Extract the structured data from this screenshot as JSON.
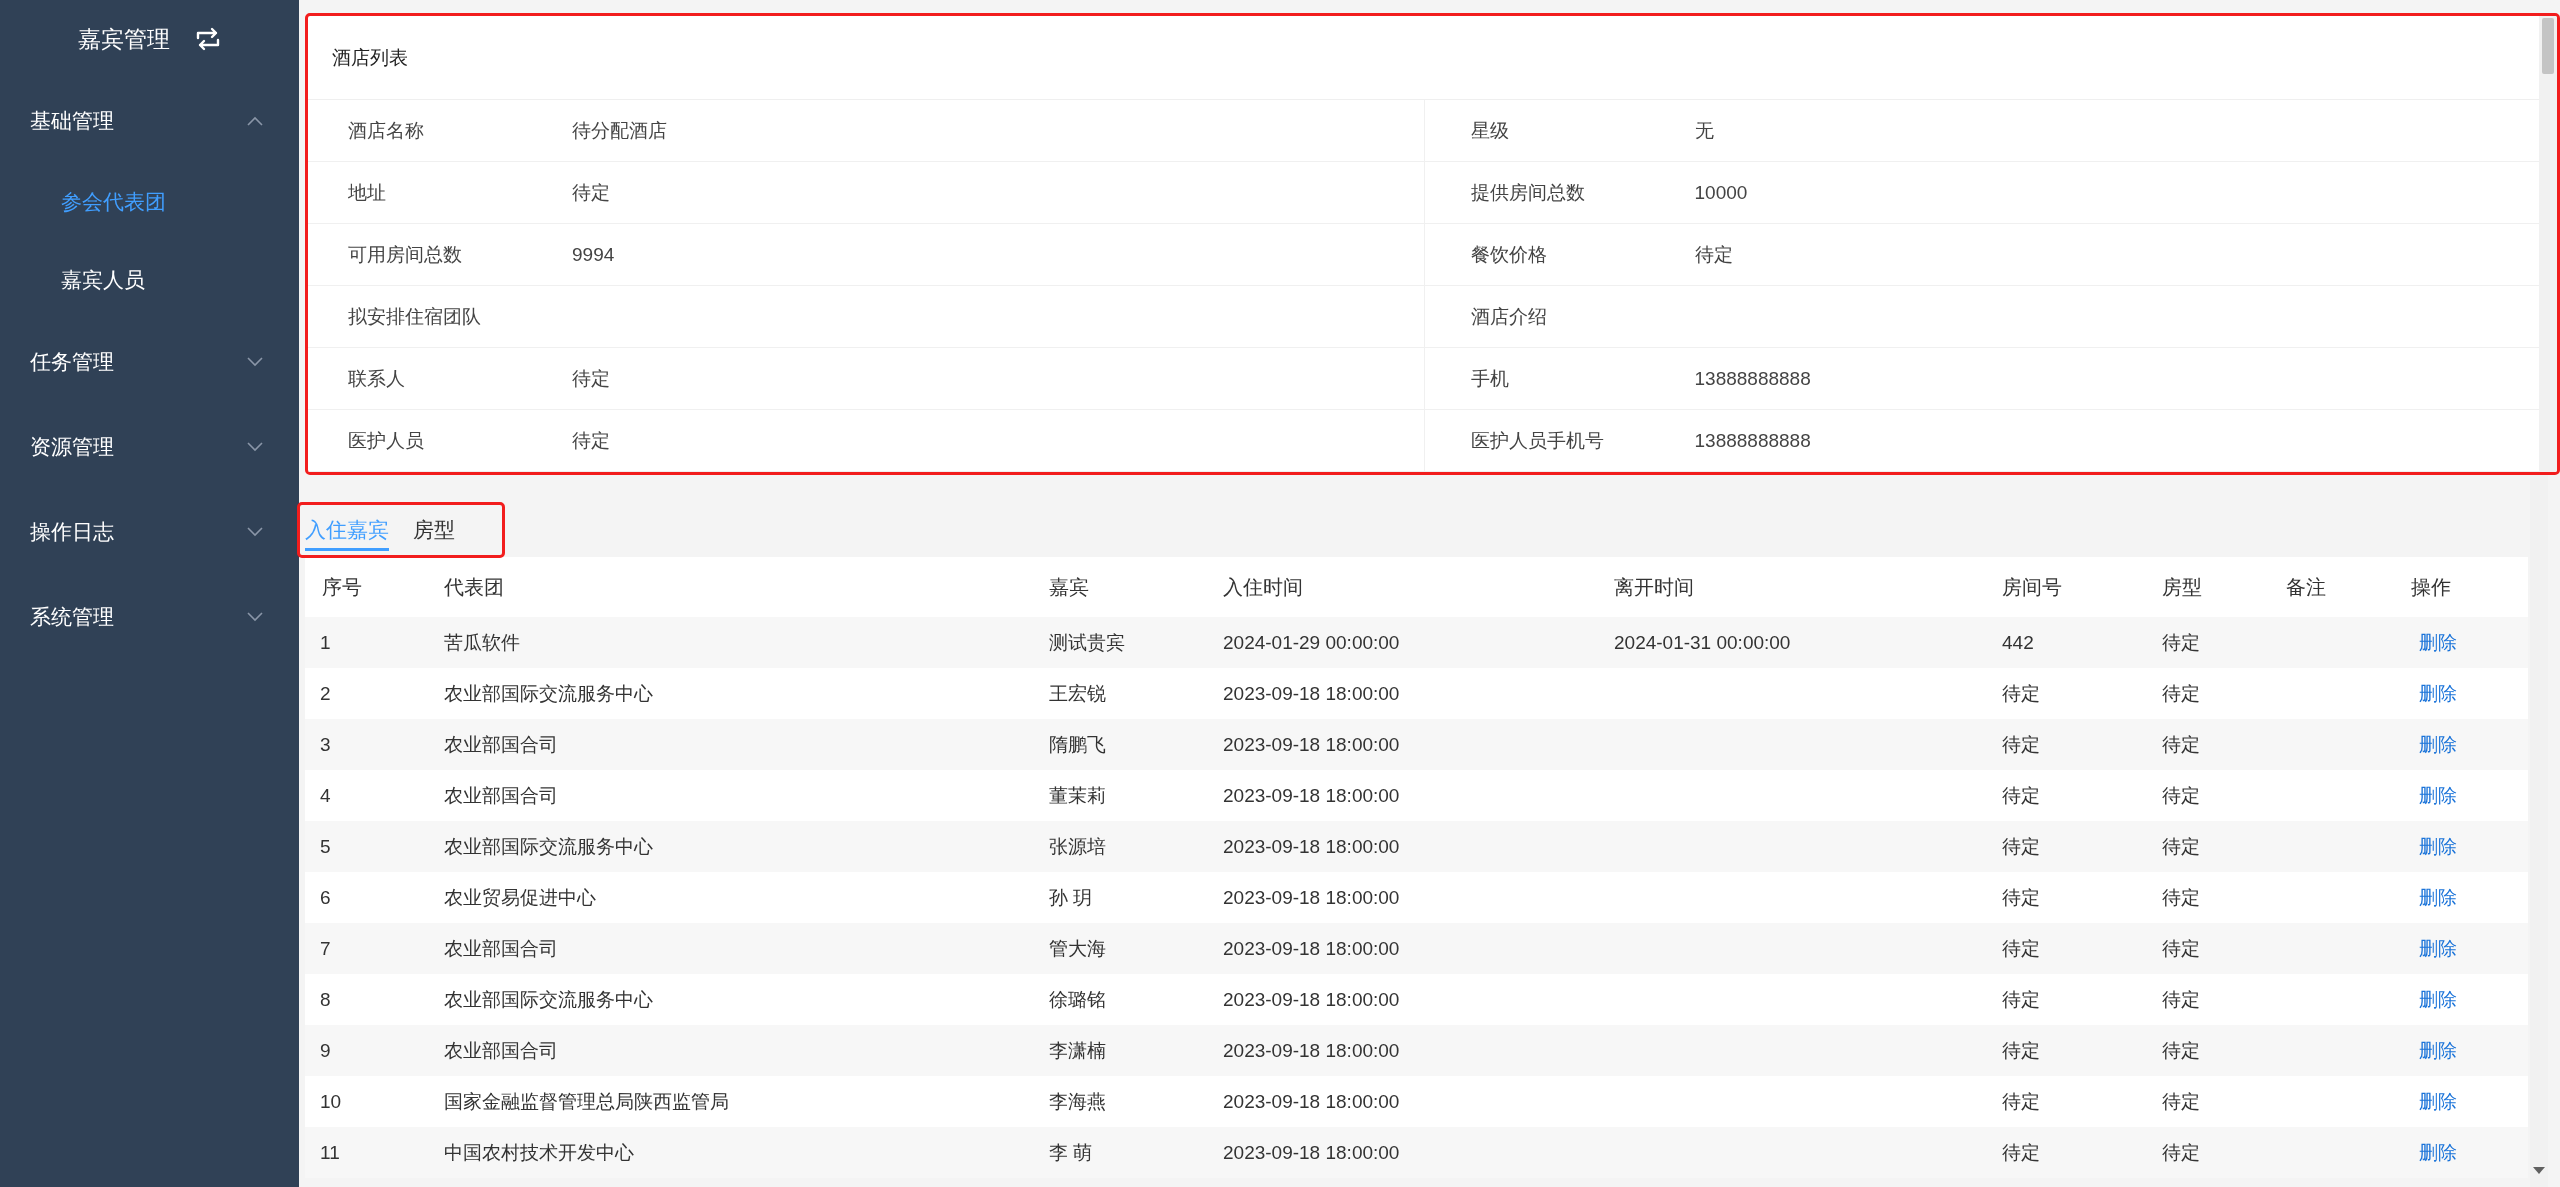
{
  "sidebar": {
    "title": "嘉宾管理",
    "groups": [
      {
        "label": "基础管理",
        "expanded": true,
        "children": [
          {
            "label": "参会代表团",
            "selected": true
          },
          {
            "label": "嘉宾人员",
            "selected": false
          }
        ]
      },
      {
        "label": "任务管理",
        "expanded": false
      },
      {
        "label": "资源管理",
        "expanded": false
      },
      {
        "label": "操作日志",
        "expanded": false
      },
      {
        "label": "系统管理",
        "expanded": false
      }
    ]
  },
  "hotel_card": {
    "title": "酒店列表",
    "fields": [
      {
        "label": "酒店名称",
        "value": "待分配酒店"
      },
      {
        "label": "星级",
        "value": "无"
      },
      {
        "label": "地址",
        "value": "待定"
      },
      {
        "label": "提供房间总数",
        "value": "10000"
      },
      {
        "label": "可用房间总数",
        "value": "9994"
      },
      {
        "label": "餐饮价格",
        "value": "待定"
      },
      {
        "label": "拟安排住宿团队"
      },
      {
        "label": "酒店介绍"
      },
      {
        "label": "联系人",
        "value": "待定"
      },
      {
        "label": "手机",
        "value": "13888888888"
      },
      {
        "label": "医护人员",
        "value": "待定"
      },
      {
        "label": "医护人员手机号",
        "value": "13888888888"
      }
    ]
  },
  "tabs": [
    {
      "label": "入住嘉宾",
      "selected": true
    },
    {
      "label": "房型",
      "selected": false
    }
  ],
  "table": {
    "columns": [
      "序号",
      "代表团",
      "嘉宾",
      "入住时间",
      "离开时间",
      "房间号",
      "房型",
      "备注",
      "操作"
    ],
    "rows": [
      {
        "no": "1",
        "delegation": "苦瓜软件",
        "guest": "测试贵宾",
        "check_in": "2024-01-29 00:00:00",
        "check_out": "2024-01-31 00:00:00",
        "room_no": "442",
        "room_type": "待定",
        "action": "删除"
      },
      {
        "no": "2",
        "delegation": "农业部国际交流服务中心",
        "guest": "王宏锐",
        "check_in": "2023-09-18 18:00:00",
        "room_no": "待定",
        "room_type": "待定",
        "action": "删除"
      },
      {
        "no": "3",
        "delegation": "农业部国合司",
        "guest": "隋鹏飞",
        "check_in": "2023-09-18 18:00:00",
        "room_no": "待定",
        "room_type": "待定",
        "action": "删除"
      },
      {
        "no": "4",
        "delegation": "农业部国合司",
        "guest": "董茉莉",
        "check_in": "2023-09-18 18:00:00",
        "room_no": "待定",
        "room_type": "待定",
        "action": "删除"
      },
      {
        "no": "5",
        "delegation": "农业部国际交流服务中心",
        "guest": "张源培",
        "check_in": "2023-09-18 18:00:00",
        "room_no": "待定",
        "room_type": "待定",
        "action": "删除"
      },
      {
        "no": "6",
        "delegation": "农业贸易促进中心",
        "guest": "孙 玥",
        "check_in": "2023-09-18 18:00:00",
        "room_no": "待定",
        "room_type": "待定",
        "action": "删除"
      },
      {
        "no": "7",
        "delegation": "农业部国合司",
        "guest": "管大海",
        "check_in": "2023-09-18 18:00:00",
        "room_no": "待定",
        "room_type": "待定",
        "action": "删除"
      },
      {
        "no": "8",
        "delegation": "农业部国际交流服务中心",
        "guest": "徐璐铭",
        "check_in": "2023-09-18 18:00:00",
        "room_no": "待定",
        "room_type": "待定",
        "action": "删除"
      },
      {
        "no": "9",
        "delegation": "农业部国合司",
        "guest": "李潇楠",
        "check_in": "2023-09-18 18:00:00",
        "room_no": "待定",
        "room_type": "待定",
        "action": "删除"
      },
      {
        "no": "10",
        "delegation": "国家金融监督管理总局陕西监管局",
        "guest": "李海燕",
        "check_in": "2023-09-18 18:00:00",
        "room_no": "待定",
        "room_type": "待定",
        "action": "删除"
      },
      {
        "no": "11",
        "delegation": "中国农村技术开发中心",
        "guest": "李 萌",
        "check_in": "2023-09-18 18:00:00",
        "room_no": "待定",
        "room_type": "待定",
        "action": "删除"
      }
    ]
  }
}
